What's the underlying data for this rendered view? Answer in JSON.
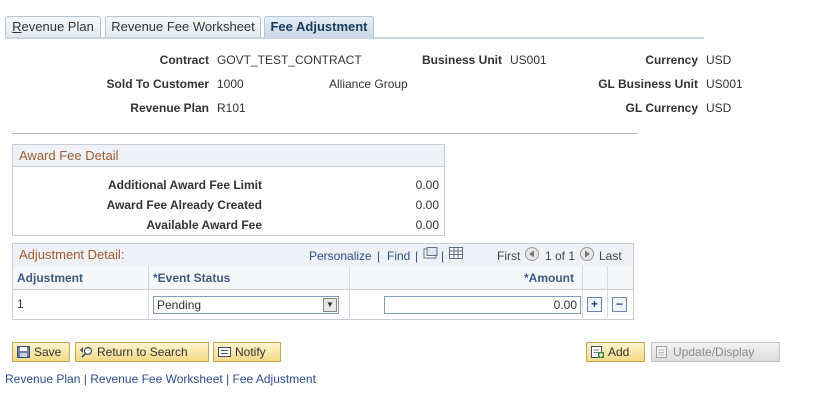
{
  "tabs": [
    {
      "label": "Revenue Plan",
      "underline": "R",
      "rest": "evenue Plan"
    },
    {
      "label": "Revenue Fee Worksheet",
      "underline": "",
      "rest": "Revenue Fee Worksheet"
    },
    {
      "label": "Fee Adjustment",
      "underline": "",
      "rest": "Fee Adjustment"
    }
  ],
  "header": {
    "contract_label": "Contract",
    "contract_value": "GOVT_TEST_CONTRACT",
    "business_unit_label": "Business Unit",
    "business_unit_value": "US001",
    "currency_label": "Currency",
    "currency_value": "USD",
    "sold_to_label": "Sold To Customer",
    "sold_to_value": "1000",
    "sold_to_name": "Alliance Group",
    "gl_bu_label": "GL Business Unit",
    "gl_bu_value": "US001",
    "revenue_plan_label": "Revenue Plan",
    "revenue_plan_value": "R101",
    "gl_currency_label": "GL Currency",
    "gl_currency_value": "USD"
  },
  "award_fee": {
    "title": "Award Fee Detail",
    "rows": [
      {
        "label": "Additional Award Fee Limit",
        "value": "0.00"
      },
      {
        "label": "Award Fee Already Created",
        "value": "0.00"
      },
      {
        "label": "Available Award Fee",
        "value": "0.00"
      }
    ]
  },
  "adjustment": {
    "title": "Adjustment Detail:",
    "personalize": "Personalize",
    "separator": "|",
    "find": "Find",
    "first": "First",
    "range": "1 of 1",
    "last": "Last",
    "columns": {
      "adjustment": "Adjustment",
      "event_status": "*Event Status",
      "amount": "*Amount"
    },
    "row": {
      "adjustment": "1",
      "event_status": "Pending",
      "amount": "0.00"
    }
  },
  "buttons": {
    "save": "Save",
    "return": "Return to Search",
    "notify": "Notify",
    "add": "Add",
    "update": "Update/Display"
  },
  "footer_nav": {
    "revenue_plan": "Revenue Plan",
    "revenue_fee_worksheet": "Revenue Fee Worksheet",
    "fee_adjustment": "Fee Adjustment",
    "sep": "|"
  },
  "colors": {
    "group_title": "#a05a2c",
    "link": "#2a4d8f",
    "button_fill": "#f2d986"
  }
}
